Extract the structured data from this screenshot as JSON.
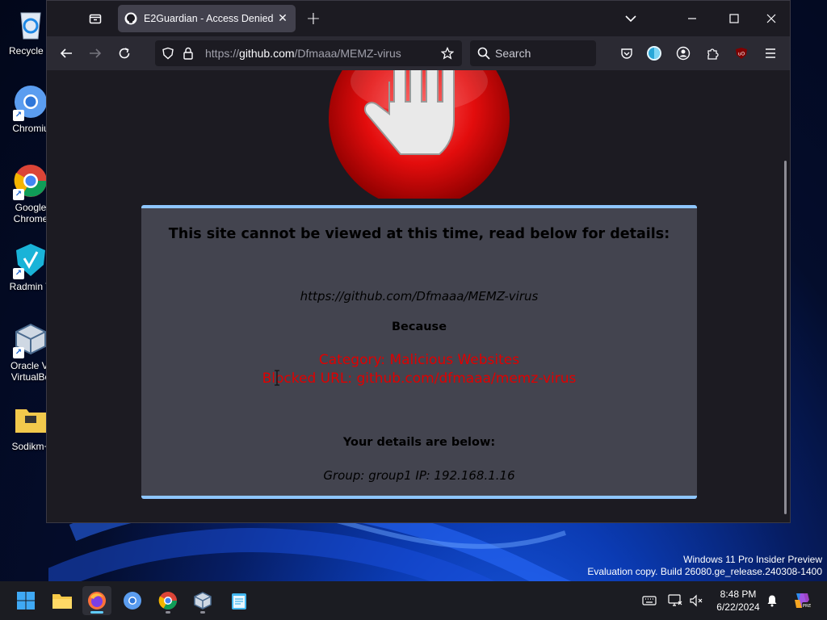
{
  "desktop": {
    "icons": [
      {
        "label": "Recycle B",
        "icon": "recycle-bin-icon"
      },
      {
        "label": "Chromiu",
        "icon": "chromium-icon"
      },
      {
        "label": "Google\nChrome",
        "icon": "chrome-icon"
      },
      {
        "label": "Radmin V",
        "icon": "radmin-vpn-icon"
      },
      {
        "label": "Oracle VI\nVirtualBo",
        "icon": "virtualbox-icon"
      },
      {
        "label": "Sodikm+",
        "icon": "folder-icon"
      }
    ]
  },
  "browser": {
    "tab": {
      "title": "E2Guardian - Access Denied",
      "favicon": "github-icon"
    },
    "address": {
      "prefix": "https://",
      "host": "github.com",
      "path": "/Dfmaaa/MEMZ-virus"
    },
    "search_placeholder": "Search"
  },
  "page": {
    "heading": "This site cannot be viewed at this time, read below for details:",
    "blocked_url": "https://github.com/Dfmaaa/MEMZ-virus",
    "because_label": "Because",
    "reason_category": "Category: Malicious Websites",
    "reason_blocked": "Blocked URL: github.com/dfmaaa/memz-virus",
    "details_label": "Your details are below:",
    "details_info": "Group: group1   IP: 192.168.1.16"
  },
  "watermark": {
    "line1": "Windows 11 Pro Insider Preview",
    "line2": "Evaluation copy. Build 26080.ge_release.240308-1400"
  },
  "taskbar": {
    "apps": [
      "start-icon",
      "file-explorer-icon",
      "firefox-icon",
      "chromium-icon",
      "chrome-icon",
      "virtualbox-icon",
      "notepad-icon"
    ],
    "time": "8:48 PM",
    "date": "6/22/2024"
  },
  "colors": {
    "panel_bg": "#43444f",
    "panel_border": "#8ec6ff",
    "reason_text": "#e00000",
    "browser_bg": "#1c1b22",
    "toolbar_bg": "#2b2a33"
  }
}
